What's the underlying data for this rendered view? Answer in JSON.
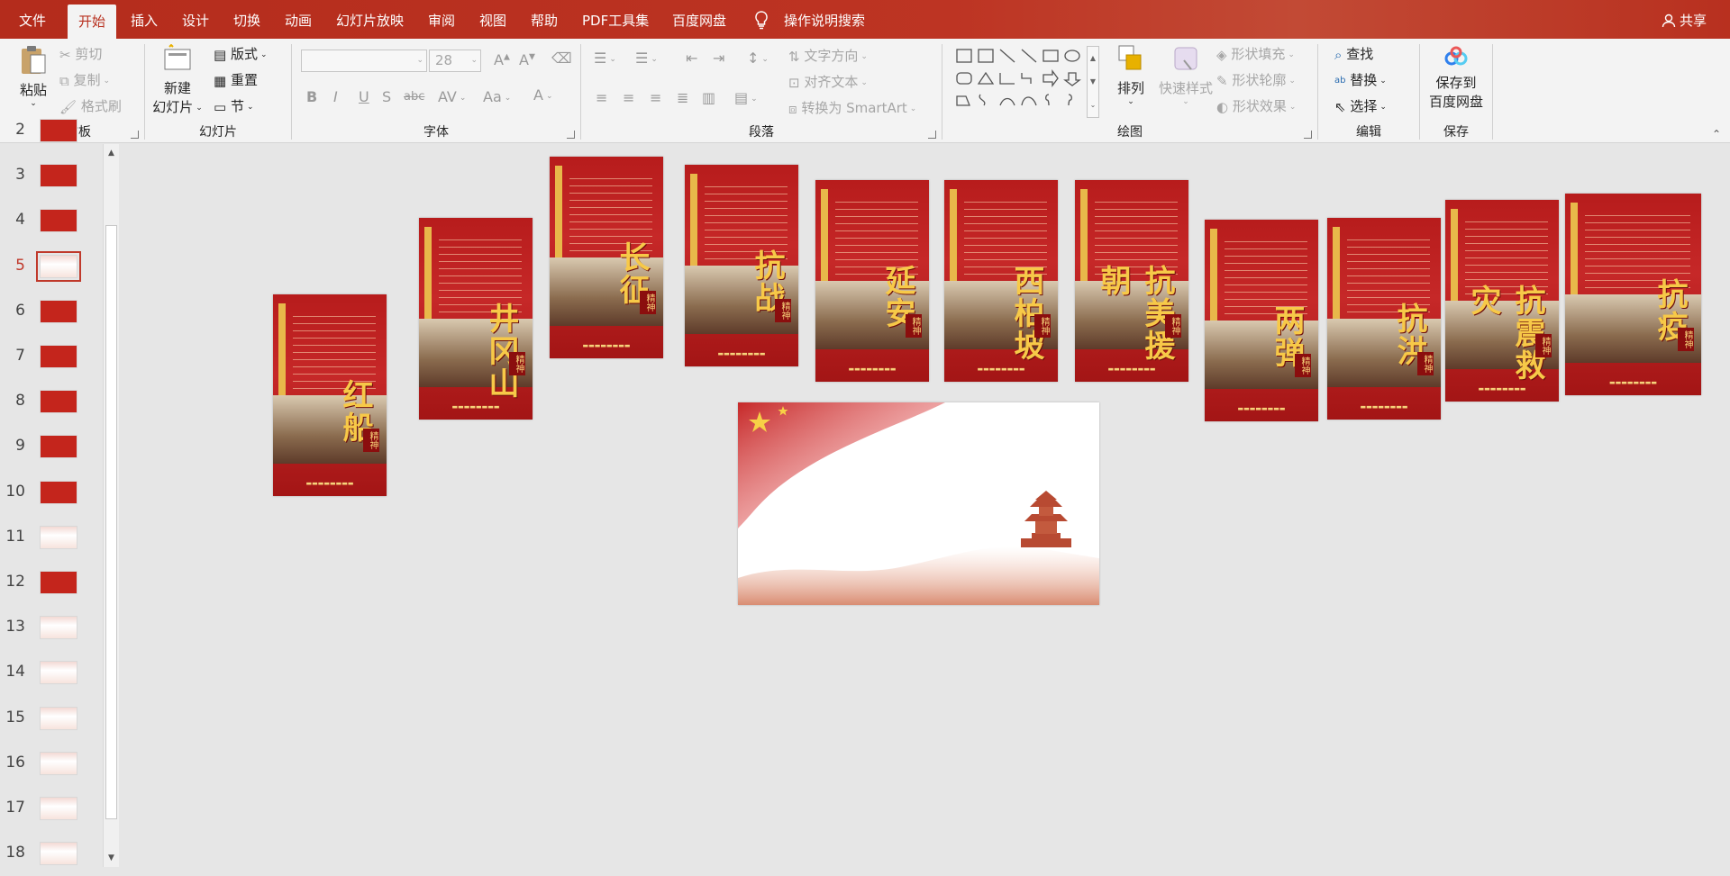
{
  "tabs": [
    {
      "label": "文件"
    },
    {
      "label": "开始"
    },
    {
      "label": "插入"
    },
    {
      "label": "设计"
    },
    {
      "label": "切换"
    },
    {
      "label": "动画"
    },
    {
      "label": "幻灯片放映"
    },
    {
      "label": "审阅"
    },
    {
      "label": "视图"
    },
    {
      "label": "帮助"
    },
    {
      "label": "PDF工具集"
    },
    {
      "label": "百度网盘"
    }
  ],
  "search_label": "操作说明搜索",
  "share_label": "共享",
  "ribbon": {
    "clipboard": {
      "paste": "粘贴",
      "cut": "剪切",
      "copy": "复制",
      "format_painter": "格式刷",
      "label": "剪贴板"
    },
    "slides": {
      "new_slide_line1": "新建",
      "new_slide_line2": "幻灯片",
      "layout": "版式",
      "reset": "重置",
      "section": "节",
      "label": "幻灯片"
    },
    "font": {
      "font_name": "",
      "font_size": "28",
      "label": "字体"
    },
    "paragraph": {
      "text_direction": "文字方向",
      "align_text": "对齐文本",
      "smartart": "转换为 SmartArt",
      "label": "段落"
    },
    "drawing": {
      "arrange": "排列",
      "quick_styles": "快速样式",
      "shape_fill": "形状填充",
      "shape_outline": "形状轮廓",
      "shape_effects": "形状效果",
      "label": "绘图"
    },
    "editing": {
      "find": "查找",
      "replace": "替换",
      "select": "选择",
      "label": "编辑"
    },
    "save": {
      "line1": "保存到",
      "line2": "百度网盘",
      "label": "保存"
    }
  },
  "thumbnails": [
    {
      "num": "2",
      "current": false
    },
    {
      "num": "3",
      "current": false
    },
    {
      "num": "4",
      "current": false
    },
    {
      "num": "5",
      "current": true
    },
    {
      "num": "6",
      "current": false
    },
    {
      "num": "7",
      "current": false
    },
    {
      "num": "8",
      "current": false
    },
    {
      "num": "9",
      "current": false
    },
    {
      "num": "10",
      "current": false
    },
    {
      "num": "11",
      "current": false
    },
    {
      "num": "12",
      "current": false
    },
    {
      "num": "13",
      "current": false
    },
    {
      "num": "14",
      "current": false
    },
    {
      "num": "15",
      "current": false
    },
    {
      "num": "16",
      "current": false
    },
    {
      "num": "17",
      "current": false
    },
    {
      "num": "18",
      "current": false
    }
  ],
  "posters": [
    {
      "title": "红船",
      "tag": "精神"
    },
    {
      "title": "井冈山",
      "tag": "精神"
    },
    {
      "title": "长征",
      "tag": "精神"
    },
    {
      "title": "抗战",
      "tag": "精神"
    },
    {
      "title": "延安",
      "tag": "精神"
    },
    {
      "title": "西柏坡",
      "tag": "精神"
    },
    {
      "title": "抗美援朝",
      "tag": "精神"
    },
    {
      "title": "两弹",
      "tag": "精神"
    },
    {
      "title": "抗洪",
      "tag": "精神"
    },
    {
      "title": "抗震救灾",
      "tag": "精神"
    },
    {
      "title": "抗疫",
      "tag": "精神"
    }
  ],
  "colors": {
    "accent": "#b8301f",
    "selected": "#c0392b"
  }
}
